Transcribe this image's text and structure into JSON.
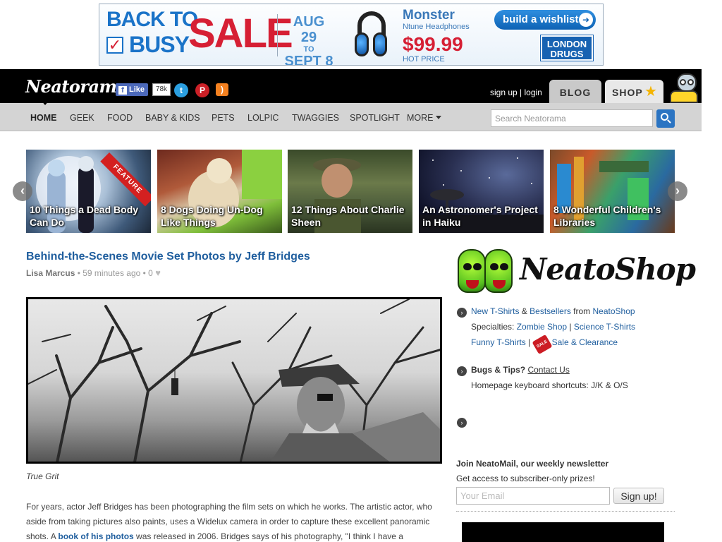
{
  "ad": {
    "back_to": "BACK TO",
    "busy": "BUSY",
    "sale": "SALE",
    "date_start": "AUG 29",
    "date_to": "TO",
    "date_end": "SEPT 8",
    "brand": "Monster",
    "model": "Ntune Headphones",
    "price": "$99.99",
    "price_note": "HOT PRICE",
    "wishlist_label": "build a wishlist",
    "advertiser": "LONDON DRUGS"
  },
  "header": {
    "logo": "Neatorama",
    "fb_like_label": "Like",
    "fb_like_count": "78k",
    "sign_up": "sign up",
    "separator": " | ",
    "login": "login",
    "tab_blog": "BLOG",
    "tab_shop": "SHOP"
  },
  "nav": {
    "items": [
      "HOME",
      "GEEK",
      "FOOD",
      "BABY & KIDS",
      "PETS",
      "LOLPIC",
      "TWAGGIES",
      "SPOTLIGHT"
    ],
    "more": "MORE",
    "search_placeholder": "Search Neatorama"
  },
  "carousel": {
    "feature_badge": "FEATURE",
    "slides": [
      {
        "caption": "10 Things a Dead Body Can Do"
      },
      {
        "caption": "8 Dogs Doing Un-Dog Like Things"
      },
      {
        "caption": "12 Things About Charlie Sheen"
      },
      {
        "caption": "An Astronomer's Project in Haiku"
      },
      {
        "caption": "8 Wonderful Children's Libraries"
      }
    ]
  },
  "article": {
    "title": "Behind-the-Scenes Movie Set Photos by Jeff Bridges",
    "author": "Lisa Marcus",
    "time": " • 59 minutes ago • 0 ",
    "photo_caption": "True Grit",
    "body_1": "For years, actor Jeff Bridges has been photographing the film sets on which he works. The artistic actor, who aside from taking pictures also paints, uses a Widelux camera in order to capture these excellent panoramic shots. A ",
    "body_link": "book of his photos",
    "body_2": " was released in 2006. Bridges says of his photography, \"I think I have a"
  },
  "sidebar": {
    "shop_title": "NeatoShop",
    "line1_new": "New T-Shirts",
    "line1_amp": " & ",
    "line1_best": "Bestsellers",
    "line1_from": " from ",
    "line1_shop": "NeatoShop",
    "specialties_label": "Specialties: ",
    "zombie": "Zombie Shop",
    "pipe": " | ",
    "science": "Science T-Shirts",
    "funny": "Funny T-Shirts",
    "sale_tag": "SALE",
    "sale_clearance": "Sale & Clearance",
    "bugs_label": "Bugs & Tips?",
    "contact": "Contact Us",
    "shortcuts": "Homepage keyboard shortcuts: J/K & O/S",
    "newsletter_title": "Join NeatoMail, our weekly newsletter",
    "newsletter_sub": "Get access to subscriber-only prizes!",
    "email_placeholder": "Your Email",
    "signup_button": "Sign up!"
  }
}
